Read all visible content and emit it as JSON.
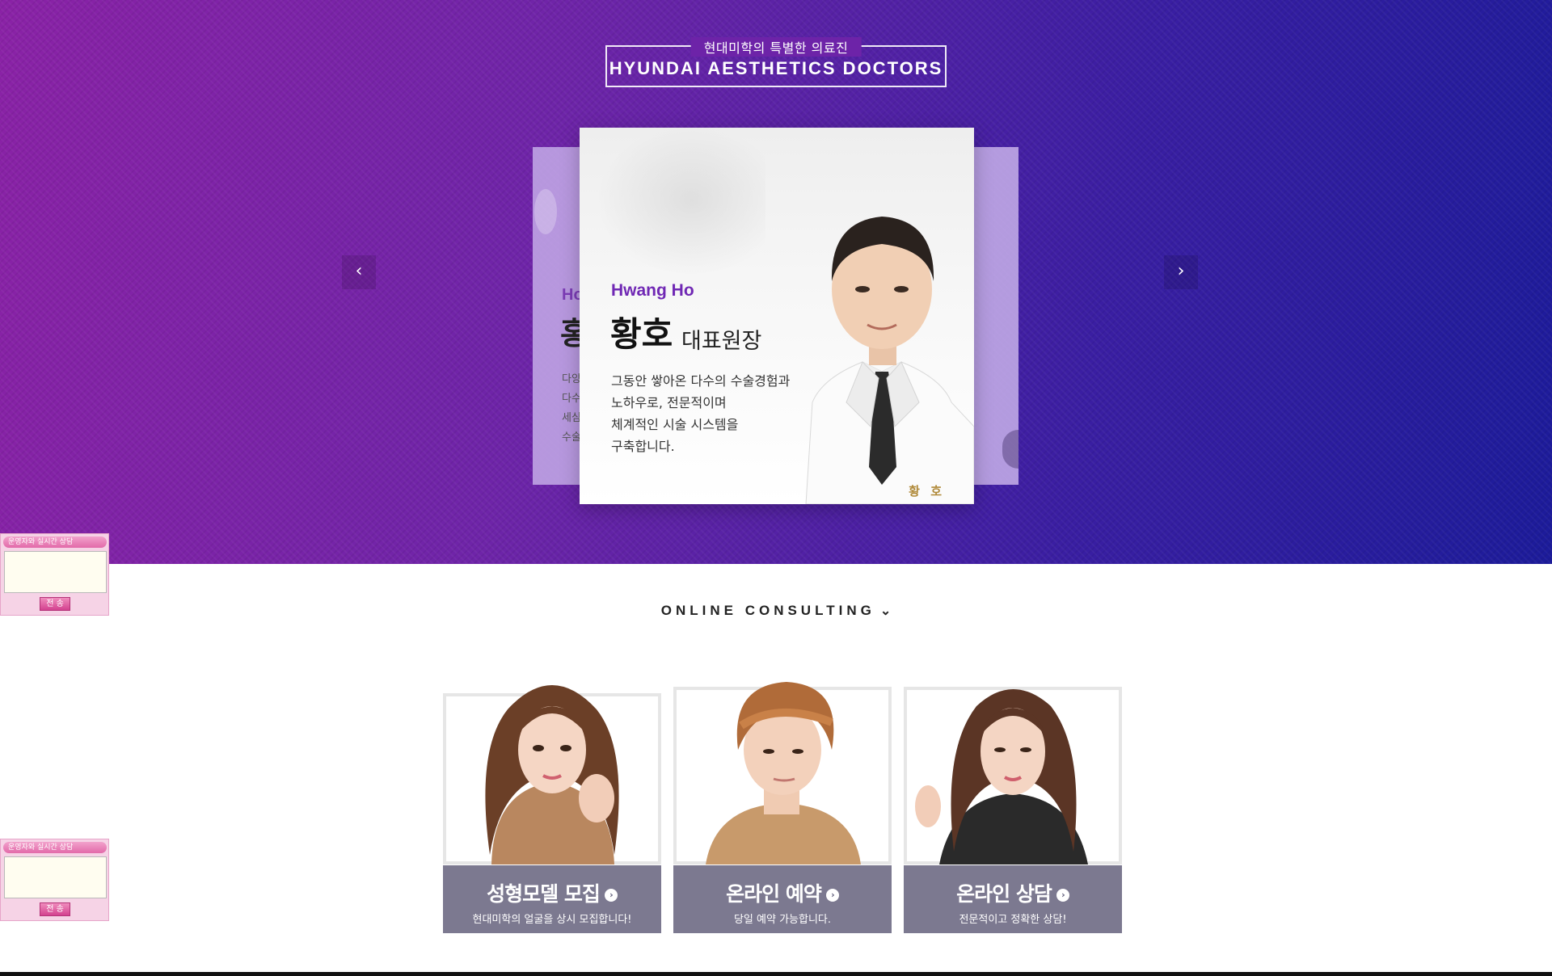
{
  "hero": {
    "title_kr": "현대미학의 특별한 의료진",
    "title_en": "HYUNDAI AESTHETICS DOCTORS",
    "prev_label": "‹",
    "next_label": "›",
    "peek_card": {
      "name_en": "Ho",
      "name_kr": "홍",
      "lines": [
        "다양",
        "다수",
        "세심",
        "수술"
      ]
    },
    "doctor": {
      "name_en": "Hwang Ho",
      "name_kr": "황호",
      "role": "대표원장",
      "desc": [
        "그동안 쌓아온 다수의 수술경험과",
        "노하우로, 전문적이며",
        "체계적인 시술 시스템을",
        "구축합니다."
      ],
      "badge_name": "황 호"
    }
  },
  "chat_widget": {
    "title": "운영자와 실시간 상담",
    "send_label": "전 송"
  },
  "consulting": {
    "title": "ONLINE CONSULTING",
    "chevron": "⌄",
    "cards": [
      {
        "title": "성형모델 모집",
        "subtitle": "현대미학의 얼굴을 상시 모집합니다!"
      },
      {
        "title": "온라인 예약",
        "subtitle": "당일 예약 가능합니다."
      },
      {
        "title": "온라인 상담",
        "subtitle": "전문적이고 정확한 상담!"
      }
    ],
    "go_icon": "›"
  },
  "colors": {
    "hero_start": "#8a22a6",
    "hero_end": "#1c1b9a",
    "accent_name": "#7028b4",
    "label_bg": "#5f5c78",
    "chat_pink": "#e26aa9"
  }
}
